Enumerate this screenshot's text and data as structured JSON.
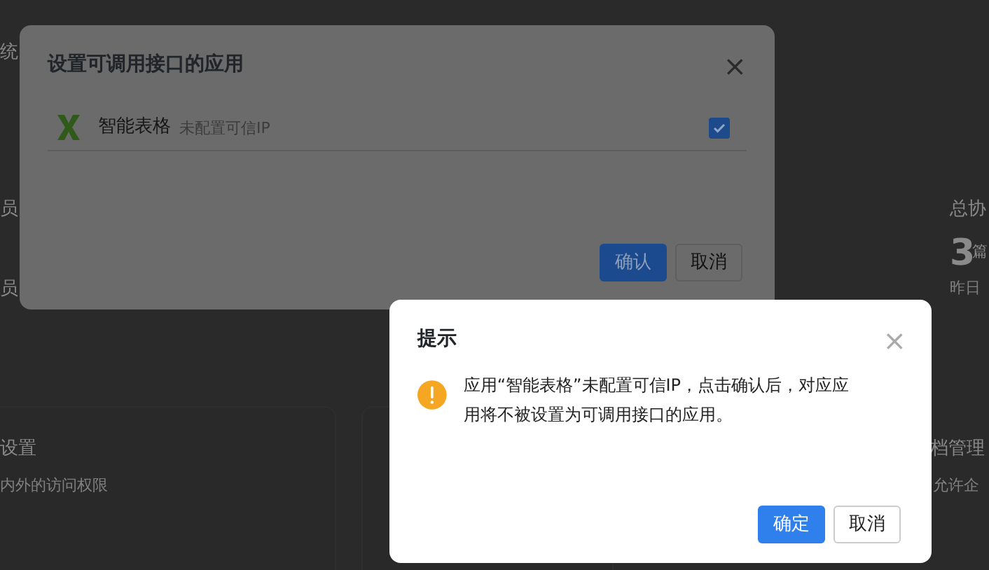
{
  "background": {
    "texts": [
      {
        "kind": "label",
        "text": "统"
      },
      {
        "kind": "label",
        "text": "员"
      },
      {
        "kind": "label",
        "text": "员"
      },
      {
        "kind": "label",
        "text": "总协"
      },
      {
        "kind": "stat",
        "text": "3"
      },
      {
        "kind": "unit",
        "text": "篇"
      },
      {
        "kind": "note",
        "text": "昨日"
      },
      {
        "kind": "label",
        "text": "设置"
      },
      {
        "kind": "note",
        "text": "内外的访问权限"
      },
      {
        "kind": "label",
        "text": "档管理"
      },
      {
        "kind": "note",
        "text": "允许企"
      }
    ]
  },
  "app_dialog": {
    "title": "设置可调用接口的应用",
    "close": "×",
    "apps": [
      {
        "name": "智能表格",
        "note": "未配置可信IP",
        "checked": true
      }
    ],
    "buttons": [
      {
        "kind": "primary",
        "label": "确认"
      },
      {
        "kind": "secondary",
        "label": "取消"
      }
    ]
  },
  "confirm_dialog": {
    "title": "提示",
    "close": "×",
    "message": "应用“智能表格”未配置可信IP，点击确认后，对应应用将不被设置为可调用接口的应用。",
    "buttons": [
      {
        "kind": "primary",
        "label": "确定"
      },
      {
        "kind": "secondary",
        "label": "取消"
      }
    ]
  }
}
